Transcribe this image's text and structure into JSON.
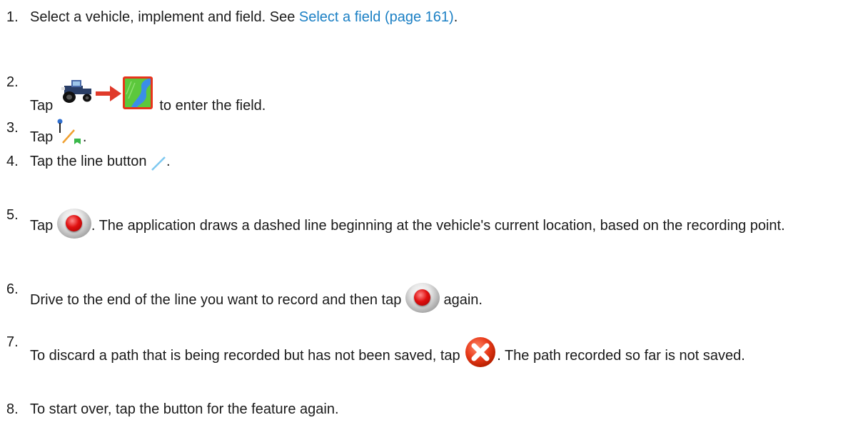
{
  "steps": [
    {
      "number": "1.",
      "text_before": "Select a vehicle, implement and field. See ",
      "link": "Select a field (page 161)",
      "text_after": "."
    },
    {
      "number": "2.",
      "text_before": "Tap ",
      "text_after": " to enter the field.",
      "icon": "vehicle-to-field-icon"
    },
    {
      "number": "3.",
      "text_before": "Tap ",
      "text_after": ".",
      "icon": "guidance-line-icon"
    },
    {
      "number": "4.",
      "text_before": "Tap the line button ",
      "text_after": ".",
      "icon": "line-icon"
    },
    {
      "number": "5.",
      "text_before": "Tap ",
      "text_after": ". The application draws a dashed line beginning at the vehicle's current location, based on the recording point.",
      "icon": "record-icon"
    },
    {
      "number": "6.",
      "text_before": "Drive to the end of the line you want to record and then tap ",
      "text_after": " again.",
      "icon": "record-icon"
    },
    {
      "number": "7.",
      "text_before": "To discard a path that is being recorded but has not been saved, tap ",
      "text_after": ". The path recorded so far is not saved.",
      "icon": "discard-icon"
    },
    {
      "number": "8.",
      "text_before": "To start over, tap the button for the feature again."
    }
  ],
  "colors": {
    "link": "#1a7fc4",
    "text": "#1a1a1a",
    "arrow": "#e03a2a",
    "field_green": "#5cc83c",
    "field_blue": "#3a8ee8",
    "line_blue": "#7ec8f0"
  }
}
